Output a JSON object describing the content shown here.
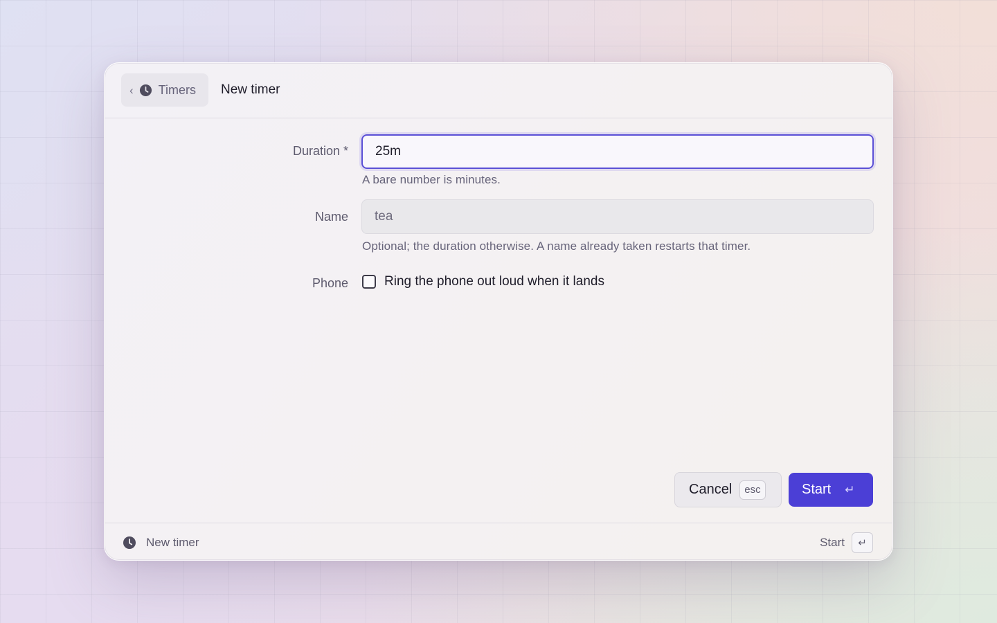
{
  "header": {
    "back_label": "Timers",
    "back_chevron": "‹",
    "back_icon": "clock-icon",
    "title": "New timer"
  },
  "form": {
    "duration": {
      "label": "Duration *",
      "value": "25m",
      "hint": "A bare number is minutes."
    },
    "name": {
      "label": "Name",
      "placeholder": "tea",
      "hint": "Optional; the duration otherwise. A name already taken restarts that timer."
    },
    "phone": {
      "label": "Phone",
      "checkbox_label": "Ring the phone out loud when it lands",
      "checked": false
    }
  },
  "actions": {
    "cancel_label": "Cancel",
    "cancel_shortcut": "esc",
    "start_label": "Start",
    "start_shortcut": "↵"
  },
  "footer": {
    "icon": "clock-icon",
    "title": "New timer",
    "action_label": "Start",
    "action_shortcut": "↵"
  },
  "colors": {
    "accent": "#4b3fd6",
    "text_primary": "#1f1d2a",
    "text_secondary": "#5e5b6e"
  }
}
